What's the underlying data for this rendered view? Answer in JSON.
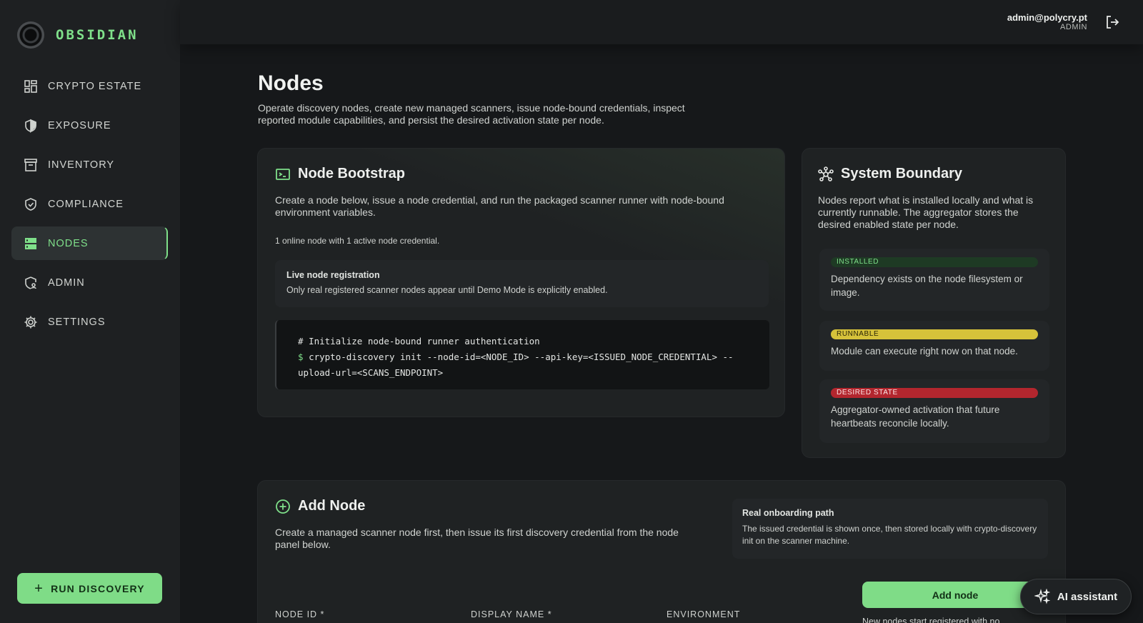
{
  "brand": {
    "name": "OBSIDIAN"
  },
  "sidebar": {
    "items": [
      {
        "label": "CRYPTO ESTATE",
        "icon": "grid-icon",
        "active": false
      },
      {
        "label": "EXPOSURE",
        "icon": "shield-icon",
        "active": false
      },
      {
        "label": "INVENTORY",
        "icon": "archive-icon",
        "active": false
      },
      {
        "label": "COMPLIANCE",
        "icon": "shield-check-icon",
        "active": false
      },
      {
        "label": "NODES",
        "icon": "server-icon",
        "active": true
      },
      {
        "label": "ADMIN",
        "icon": "shield-user-icon",
        "active": false
      },
      {
        "label": "SETTINGS",
        "icon": "gear-icon",
        "active": false
      }
    ],
    "run_button": "RUN DISCOVERY"
  },
  "topbar": {
    "email": "admin@polycry.pt",
    "role": "ADMIN"
  },
  "page": {
    "title": "Nodes",
    "subtitle": "Operate discovery nodes, create new managed scanners, issue node-bound credentials, inspect reported module capabilities, and persist the desired activation state per node."
  },
  "bootstrap": {
    "title": "Node Bootstrap",
    "description": "Create a node below, issue a node credential, and run the packaged scanner runner with node-bound environment variables.",
    "status": "1 online node with 1 active node credential.",
    "registration_title": "Live node registration",
    "registration_text": "Only real registered scanner nodes appear until Demo Mode is explicitly enabled.",
    "code_comment": "# Initialize node-bound runner authentication",
    "code_prompt": "$",
    "code_line1": "crypto-discovery init --node-id=<NODE_ID> --api-key=<ISSUED_NODE_CREDENTIAL> --",
    "code_line2": "upload-url=<SCANS_ENDPOINT>"
  },
  "boundary": {
    "title": "System Boundary",
    "description": "Nodes report what is installed locally and what is currently runnable. The aggregator stores the desired enabled state per node.",
    "states": [
      {
        "label": "INSTALLED",
        "text": "Dependency exists on the node filesystem or image.",
        "color": "#1e3a24"
      },
      {
        "label": "RUNNABLE",
        "text": "Module can execute right now on that node.",
        "color": "#d6c23a"
      },
      {
        "label": "DESIRED STATE",
        "text": "Aggregator-owned activation that future heartbeats reconcile locally.",
        "color": "#b3262e"
      }
    ]
  },
  "add_node": {
    "title": "Add Node",
    "description": "Create a managed scanner node first, then issue its first discovery credential from the node panel below.",
    "onboarding_title": "Real onboarding path",
    "onboarding_text": "The issued credential is shown once, then stored locally with crypto-discovery init on the scanner machine.",
    "fields": [
      "NODE ID *",
      "DISPLAY NAME *",
      "ENVIRONMENT"
    ],
    "button": "Add node",
    "note": "New nodes start registered with no"
  },
  "ai_assistant": {
    "label": "AI assistant"
  },
  "colors": {
    "accent": "#7fe08a",
    "background": "#16181a",
    "sidebar": "#1e2022"
  }
}
